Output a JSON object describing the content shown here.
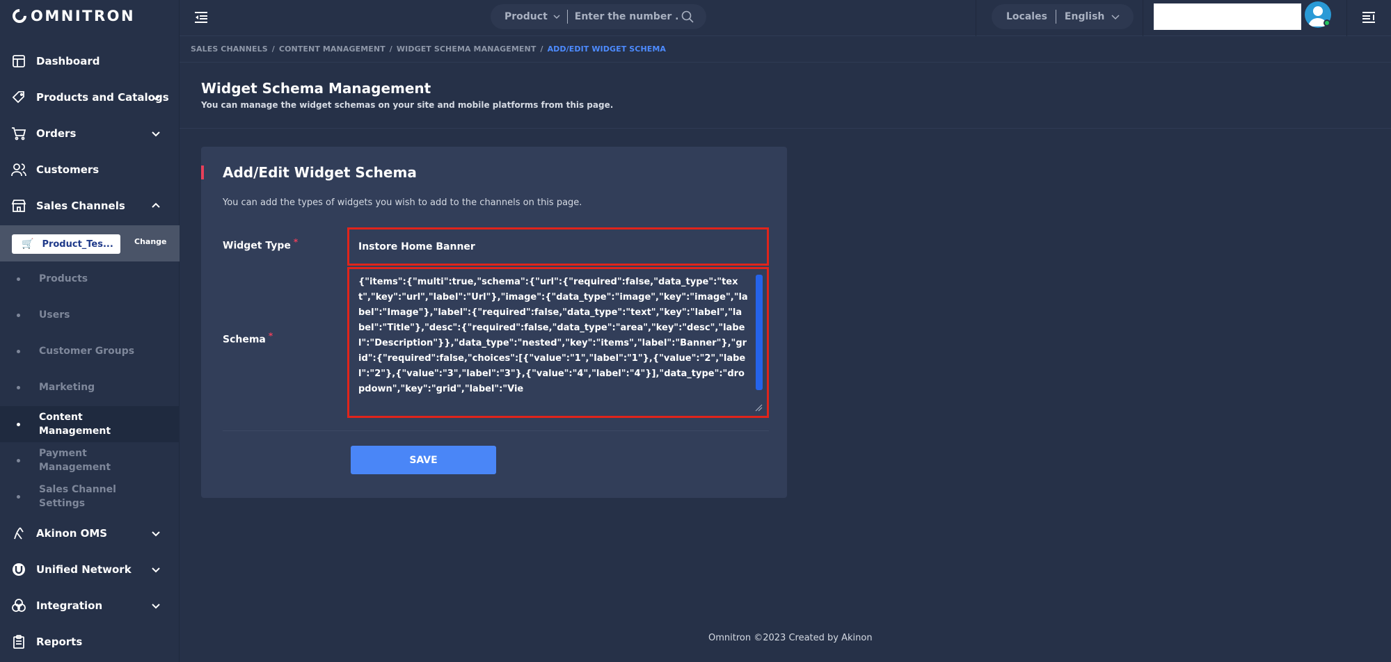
{
  "brand": {
    "name": "OMNITRON"
  },
  "sidebar": {
    "items": [
      {
        "label": "Dashboard"
      },
      {
        "label": "Products and Catalogs"
      },
      {
        "label": "Orders"
      },
      {
        "label": "Customers"
      },
      {
        "label": "Sales Channels"
      }
    ],
    "channel": {
      "name": "Product_Tes...",
      "change_label": "Change"
    },
    "sub_items": [
      {
        "label": "Products"
      },
      {
        "label": "Users"
      },
      {
        "label": "Customer Groups"
      },
      {
        "label": "Marketing"
      },
      {
        "label": "Content Management",
        "line1": "Content",
        "line2": "Management"
      },
      {
        "label": "Payment Management",
        "line1": "Payment",
        "line2": "Management"
      },
      {
        "label": "Sales Channel Settings",
        "line1": "Sales Channel",
        "line2": "Settings"
      }
    ],
    "bottom_items": [
      {
        "label": "Akinon OMS"
      },
      {
        "label": "Unified Network"
      },
      {
        "label": "Integration"
      },
      {
        "label": "Reports"
      }
    ]
  },
  "topbar": {
    "search": {
      "category": "Product",
      "placeholder": "Enter the number ..."
    },
    "locale": {
      "label": "Locales",
      "value": "English"
    }
  },
  "breadcrumb": {
    "items": [
      "SALES CHANNELS",
      "CONTENT MANAGEMENT",
      "WIDGET SCHEMA MANAGEMENT"
    ],
    "current": "ADD/EDIT WIDGET SCHEMA",
    "separator": "/"
  },
  "page": {
    "title": "Widget Schema Management",
    "subtitle": "You can manage the widget schemas on your site and mobile platforms from this page."
  },
  "form": {
    "title": "Add/Edit Widget Schema",
    "description": "You can add the types of widgets you wish to add to the channels on this page.",
    "widget_type_label": "Widget Type",
    "widget_type_value": "Instore Home Banner",
    "schema_label": "Schema",
    "required_mark": "*",
    "schema_value": "{\"items\":{\"multi\":true,\"schema\":{\"url\":{\"required\":false,\"data_type\":\"text\",\"key\":\"url\",\"label\":\"Url\"},\"image\":{\"data_type\":\"image\",\"key\":\"image\",\"label\":\"Image\"},\"label\":{\"required\":false,\"data_type\":\"text\",\"key\":\"label\",\"label\":\"Title\"},\"desc\":{\"required\":false,\"data_type\":\"area\",\"key\":\"desc\",\"label\":\"Description\"}},\"data_type\":\"nested\",\"key\":\"items\",\"label\":\"Banner\"},\"grid\":{\"required\":false,\"choices\":[{\"value\":\"1\",\"label\":\"1\"},{\"value\":\"2\",\"label\":\"2\"},{\"value\":\"3\",\"label\":\"3\"},{\"value\":\"4\",\"label\":\"4\"}],\"data_type\":\"dropdown\",\"key\":\"grid\",\"label\":\"Vie",
    "save_label": "SAVE"
  },
  "footer": {
    "text": "Omnitron ©2023 Created by Akinon"
  },
  "colors": {
    "background": "#263148",
    "card": "#323e59",
    "accent_blue": "#4a86f7",
    "highlight_red": "#e0241b",
    "required_red": "#e8405a",
    "breadcrumb_current": "#4d8bff"
  }
}
